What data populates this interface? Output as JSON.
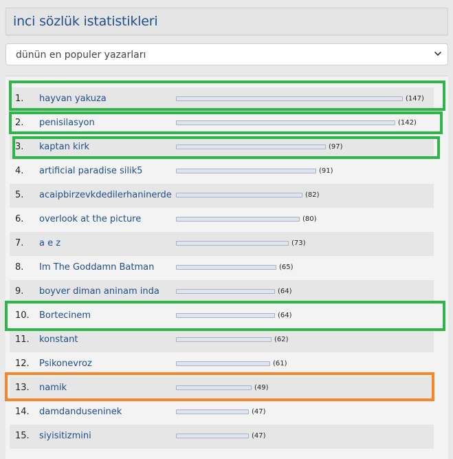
{
  "header": {
    "title": "inci sözlük istatistikleri"
  },
  "filter": {
    "selected": "dünün en populer yazarları"
  },
  "colors": {
    "highlight_green": "#2fb54a",
    "highlight_orange": "#f5872a",
    "link": "#1e4e8c"
  },
  "max_count": 147,
  "rows": [
    {
      "rank": "1.",
      "author": "hayvan yakuza",
      "count": 147,
      "count_label": "(147)",
      "highlight": "green"
    },
    {
      "rank": "2.",
      "author": "penisilasyon",
      "count": 142,
      "count_label": "(142)",
      "highlight": "green"
    },
    {
      "rank": "3.",
      "author": "kaptan kirk",
      "count": 97,
      "count_label": "(97)",
      "highlight": "green"
    },
    {
      "rank": "4.",
      "author": "artificial paradise silik5",
      "count": 91,
      "count_label": "(91)",
      "highlight": ""
    },
    {
      "rank": "5.",
      "author": "acaipbirzevkdedilerhaninerde",
      "count": 82,
      "count_label": "(82)",
      "highlight": ""
    },
    {
      "rank": "6.",
      "author": "overlook at the picture",
      "count": 80,
      "count_label": "(80)",
      "highlight": ""
    },
    {
      "rank": "7.",
      "author": "a e z",
      "count": 73,
      "count_label": "(73)",
      "highlight": ""
    },
    {
      "rank": "8.",
      "author": "Im The Goddamn Batman",
      "count": 65,
      "count_label": "(65)",
      "highlight": ""
    },
    {
      "rank": "9.",
      "author": "boyver diman aninam inda",
      "count": 64,
      "count_label": "(64)",
      "highlight": ""
    },
    {
      "rank": "10.",
      "author": "Bortecinem",
      "count": 64,
      "count_label": "(64)",
      "highlight": "green"
    },
    {
      "rank": "11.",
      "author": "konstant",
      "count": 62,
      "count_label": "(62)",
      "highlight": ""
    },
    {
      "rank": "12.",
      "author": "Psikonevroz",
      "count": 61,
      "count_label": "(61)",
      "highlight": ""
    },
    {
      "rank": "13.",
      "author": "namik",
      "count": 49,
      "count_label": "(49)",
      "highlight": "orange"
    },
    {
      "rank": "14.",
      "author": "damdanduseninek",
      "count": 47,
      "count_label": "(47)",
      "highlight": ""
    },
    {
      "rank": "15.",
      "author": "siyisitizmini",
      "count": 47,
      "count_label": "(47)",
      "highlight": ""
    }
  ]
}
